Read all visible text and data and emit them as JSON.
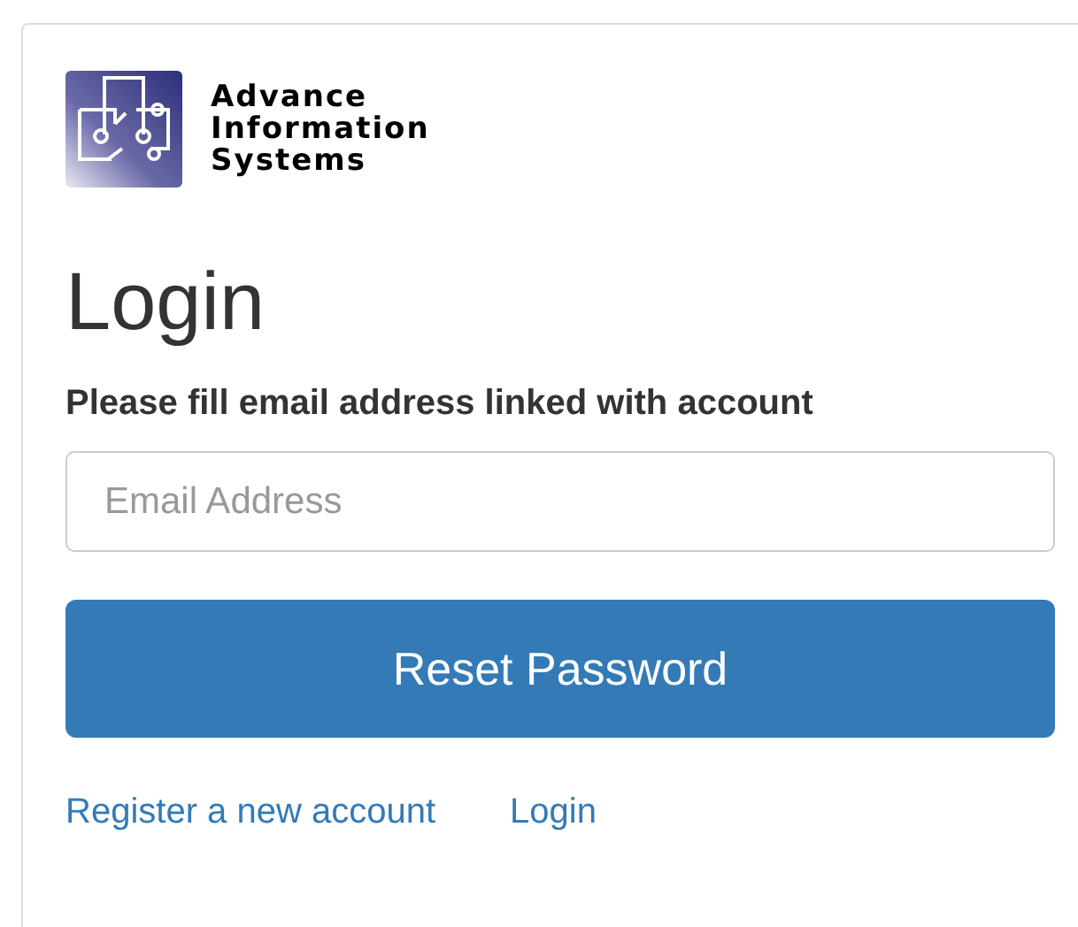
{
  "logo": {
    "lines": [
      "Advance",
      "Information",
      "Systems"
    ]
  },
  "heading": "Login",
  "form": {
    "label": "Please fill email address linked with account",
    "email": {
      "placeholder": "Email Address"
    },
    "submit": "Reset Password"
  },
  "links": [
    "Register a new account",
    "Login"
  ]
}
